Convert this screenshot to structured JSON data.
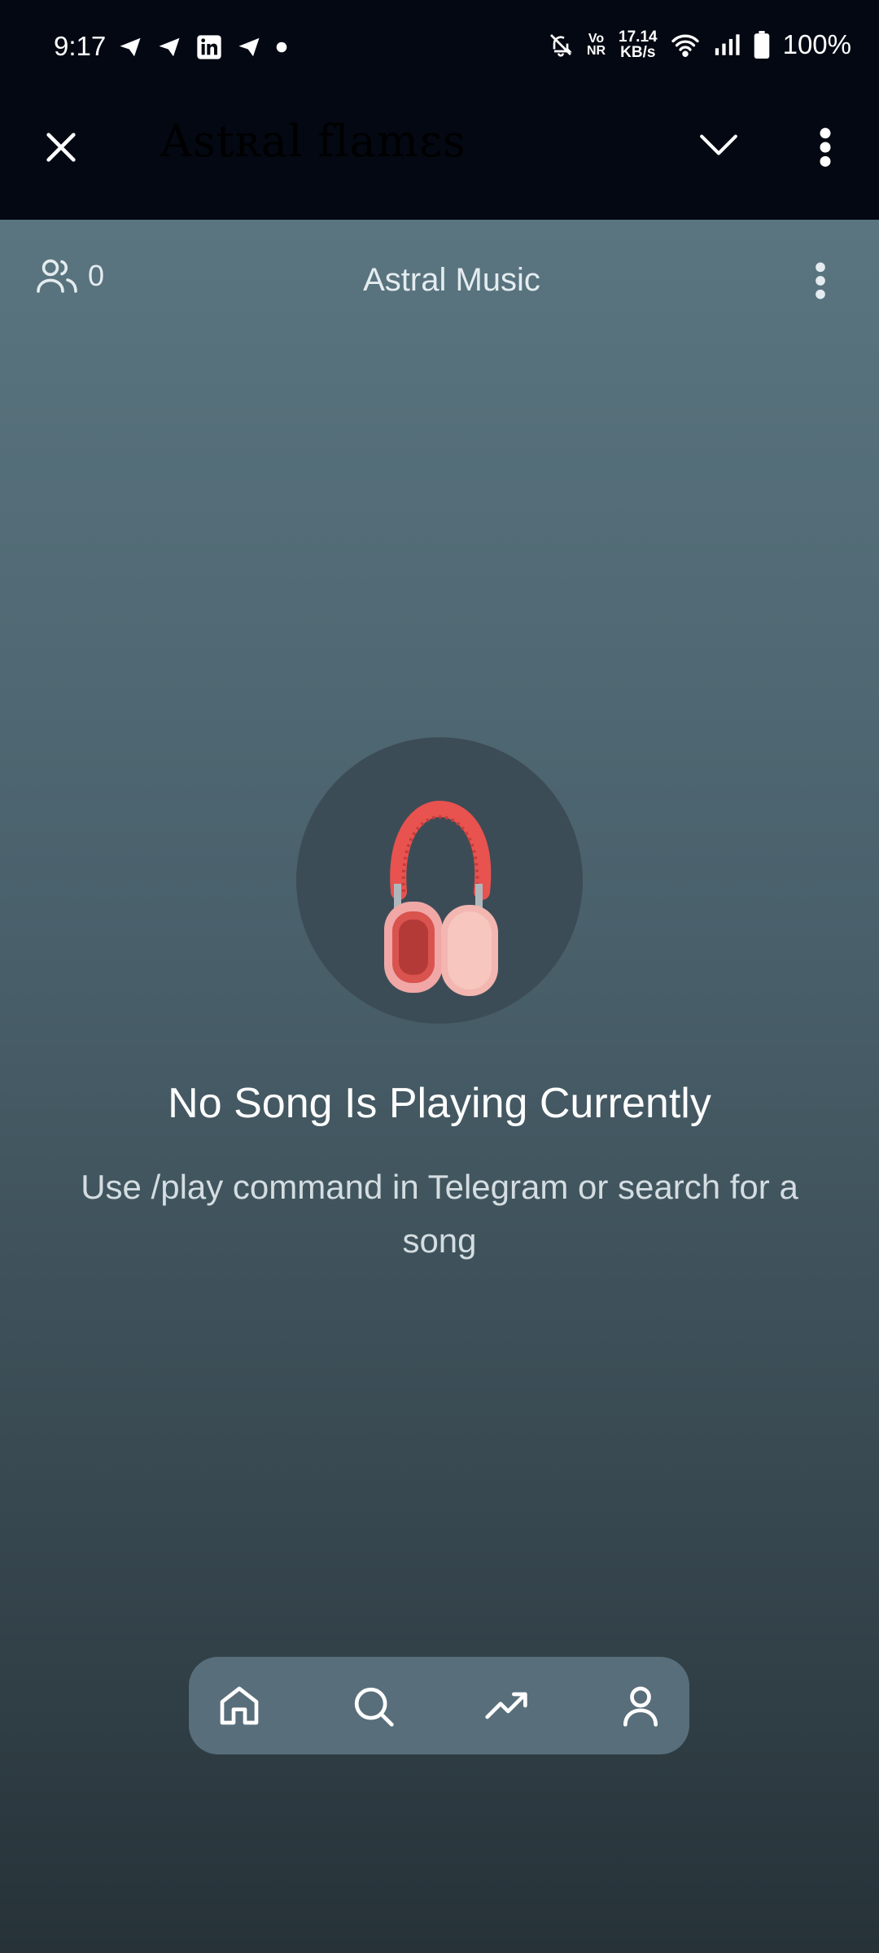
{
  "status_bar": {
    "time": "9:17",
    "network_speed_value": "17.14",
    "network_speed_unit": "KB/s",
    "volte_top": "Vo",
    "volte_bottom": "NR",
    "battery": "100%",
    "icons": [
      "telegram-icon",
      "telegram-icon",
      "linkedin-icon",
      "telegram-icon",
      "dot-icon",
      "mute-bell-icon",
      "volte-icon",
      "wifi-icon",
      "signal-icon",
      "battery-icon"
    ]
  },
  "header": {
    "title": "Astʀal flamɛs",
    "icons": [
      "close-icon",
      "chevron-down-icon",
      "more-vertical-icon"
    ]
  },
  "player": {
    "listener_count": "0",
    "app_title": "Astral Music",
    "empty_title": "No Song Is Playing Currently",
    "empty_subtitle": "Use /play command in Telegram or search for a song"
  },
  "bottom_nav": {
    "items": [
      "home",
      "search",
      "trending",
      "profile"
    ]
  },
  "colors": {
    "header_bg": "#030812",
    "gradient_top": "#5a7580",
    "gradient_bottom": "#263238",
    "nav_bg": "#586e7a",
    "headphone_red": "#e8524f"
  }
}
